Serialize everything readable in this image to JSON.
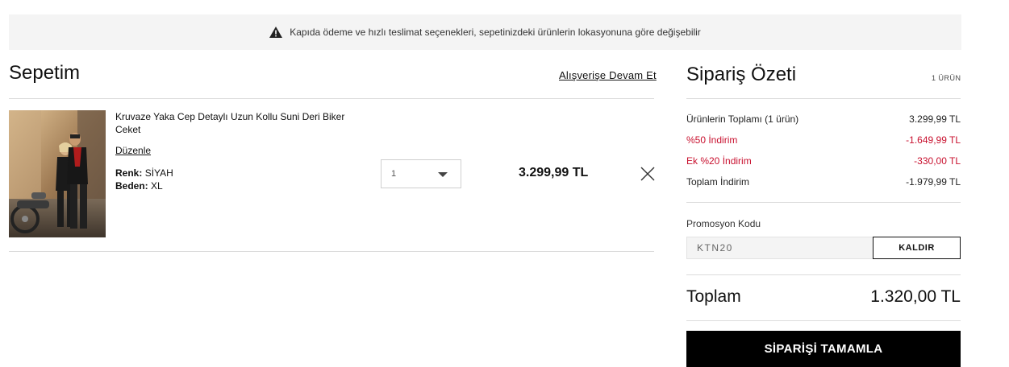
{
  "notice": {
    "icon": "warning-icon",
    "text": "Kapıda ödeme ve hızlı teslimat seçenekleri, sepetinizdeki ürünlerin lokasyonuna göre değişebilir"
  },
  "cart": {
    "title": "Sepetim",
    "continue_label": "Alışverişe Devam Et",
    "items": [
      {
        "name": "Kruvaze Yaka Cep Detaylı Uzun Kollu Suni Deri Biker Ceket",
        "edit_label": "Düzenle",
        "color_label": "Renk:",
        "color_value": "SİYAH",
        "size_label": "Beden:",
        "size_value": "XL",
        "quantity": "1",
        "price": "3.299,99 TL"
      }
    ]
  },
  "summary": {
    "title": "Sipariş Özeti",
    "count": "1 ÜRÜN",
    "rows": [
      {
        "label": "Ürünlerin Toplamı (1 ürün)",
        "value": "3.299,99 TL"
      },
      {
        "label": "%50 İndirim",
        "value": "-1.649,99 TL"
      },
      {
        "label": "Ek %20 İndirim",
        "value": "-330,00 TL"
      },
      {
        "label": "Toplam İndirim",
        "value": "-1.979,99 TL"
      }
    ],
    "promo_label": "Promosyon Kodu",
    "promo_code": "KTN20",
    "promo_button": "KALDIR",
    "total_label": "Toplam",
    "total_value": "1.320,00 TL",
    "checkout_label": "SİPARİŞİ TAMAMLA"
  },
  "colors": {
    "discount": "#c8102e",
    "checkout_bg": "#000000",
    "notice_bg": "#f4f4f4"
  }
}
